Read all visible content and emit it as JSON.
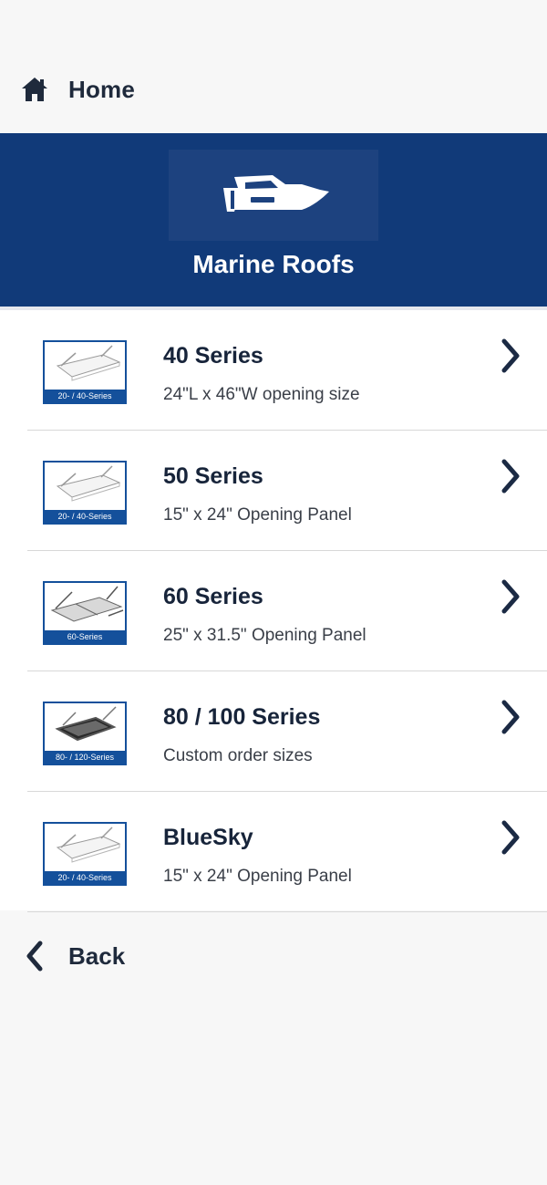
{
  "header": {
    "home_label": "Home",
    "home_icon": "home-icon"
  },
  "banner": {
    "title": "Marine Roofs",
    "icon": "boat-icon",
    "color": "#113a79"
  },
  "items": [
    {
      "title": "40 Series",
      "subtitle": "24\"L x 46\"W opening size",
      "thumb_caption": "20- / 40-Series",
      "thumb_style": "clear"
    },
    {
      "title": "50 Series",
      "subtitle": "15\" x 24\" Opening Panel",
      "thumb_caption": "20- / 40-Series",
      "thumb_style": "clear"
    },
    {
      "title": "60 Series",
      "subtitle": "25\" x 31.5\" Opening Panel",
      "thumb_caption": "60-Series",
      "thumb_style": "double"
    },
    {
      "title": "80 / 100 Series",
      "subtitle": "Custom order sizes",
      "thumb_caption": "80- / 120-Series",
      "thumb_style": "dark"
    },
    {
      "title": "BlueSky",
      "subtitle": "15\" x 24\" Opening Panel",
      "thumb_caption": "20- / 40-Series",
      "thumb_style": "clear"
    }
  ],
  "footer": {
    "back_label": "Back",
    "back_icon": "chevron-left-icon"
  }
}
